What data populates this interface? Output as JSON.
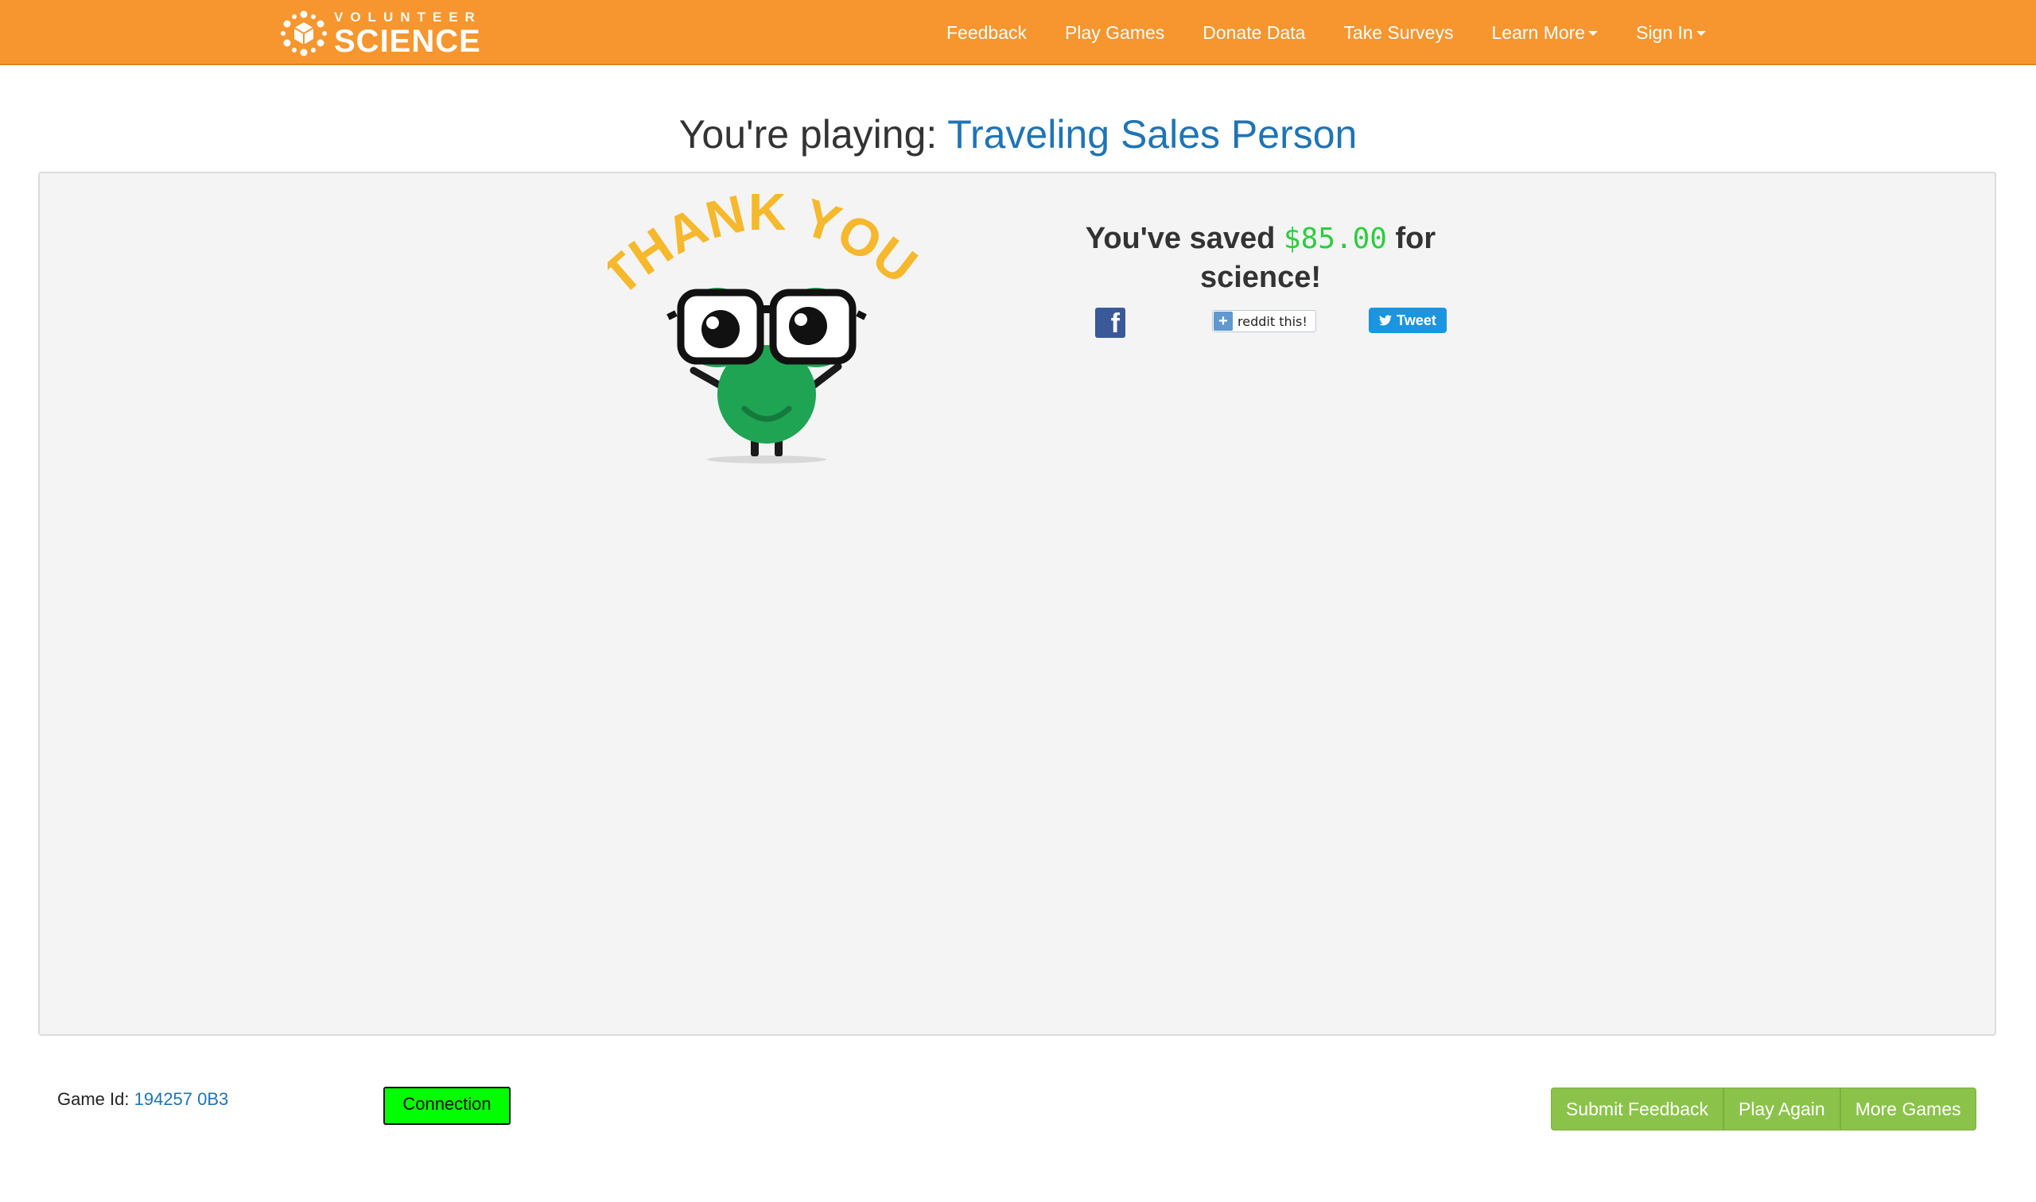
{
  "colors": {
    "navbar": "#f7962f",
    "accent_link": "#1f74b5",
    "panel_bg": "#f4f4f4",
    "amount": "#2ecc40",
    "button_green": "#8bc34a",
    "connection": "#00ff00"
  },
  "brand": {
    "top": "VOLUNTEER",
    "main": "SCIENCE",
    "logo_icon": "volunteer-science-logo-icon"
  },
  "nav": {
    "feedback": "Feedback",
    "play_games": "Play Games",
    "donate_data": "Donate Data",
    "take_surveys": "Take Surveys",
    "learn_more": "Learn More",
    "sign_in": "Sign In"
  },
  "heading": {
    "prefix": "You're playing:",
    "game": "Traveling Sales Person"
  },
  "mascot": {
    "banner": "THANK YOU!"
  },
  "results": {
    "before": "You've saved",
    "amount": "$85.00",
    "after": "for science!"
  },
  "social": {
    "facebook_glyph": "f",
    "reddit_label": "reddit this!",
    "reddit_plus": "+",
    "tweet_label": "Tweet",
    "tweet_icon": "twitter-bird-icon"
  },
  "footer": {
    "game_id_label": "Game Id:",
    "game_id_value": "194257 0B3",
    "connection_label": "Connection",
    "submit_feedback": "Submit Feedback",
    "play_again": "Play Again",
    "more_games": "More Games"
  }
}
